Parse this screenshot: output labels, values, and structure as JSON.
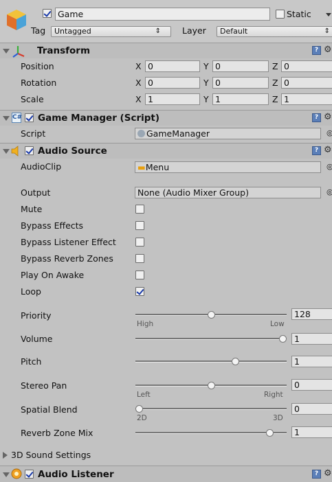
{
  "header": {
    "name": "Game",
    "static_label": "Static",
    "tag_label": "Tag",
    "tag_value": "Untagged",
    "layer_label": "Layer",
    "layer_value": "Default"
  },
  "transform": {
    "title": "Transform",
    "rows": [
      {
        "label": "Position",
        "x": "0",
        "y": "0",
        "z": "0"
      },
      {
        "label": "Rotation",
        "x": "0",
        "y": "0",
        "z": "0"
      },
      {
        "label": "Scale",
        "x": "1",
        "y": "1",
        "z": "1"
      }
    ],
    "axis_x": "X",
    "axis_y": "Y",
    "axis_z": "Z"
  },
  "game_manager": {
    "title": "Game Manager (Script)",
    "script_label": "Script",
    "script_value": "GameManager",
    "enabled": true
  },
  "audio_source": {
    "title": "Audio Source",
    "enabled": true,
    "audioclip_label": "AudioClip",
    "audioclip_value": "Menu",
    "output_label": "Output",
    "output_value": "None (Audio Mixer Group)",
    "toggles": [
      {
        "label": "Mute",
        "checked": false
      },
      {
        "label": "Bypass Effects",
        "checked": false
      },
      {
        "label": "Bypass Listener Effect",
        "checked": false
      },
      {
        "label": "Bypass Reverb Zones",
        "checked": false
      },
      {
        "label": "Play On Awake",
        "checked": false
      },
      {
        "label": "Loop",
        "checked": true
      }
    ],
    "sliders": {
      "priority": {
        "label": "Priority",
        "value": "128",
        "fraction": 0.5,
        "left": "High",
        "right": "Low"
      },
      "volume": {
        "label": "Volume",
        "value": "1",
        "fraction": 1.0
      },
      "pitch": {
        "label": "Pitch",
        "value": "1",
        "fraction": 0.67
      },
      "stereo_pan": {
        "label": "Stereo Pan",
        "value": "0",
        "fraction": 0.5,
        "left": "Left",
        "right": "Right"
      },
      "spatial_blend": {
        "label": "Spatial Blend",
        "value": "0",
        "fraction": 0.0,
        "left": "2D",
        "right": "3D"
      },
      "reverb_zone_mix": {
        "label": "Reverb Zone Mix",
        "value": "1",
        "fraction": 0.91
      }
    },
    "settings_3d_label": "3D Sound Settings"
  },
  "audio_listener": {
    "title": "Audio Listener",
    "enabled": true
  },
  "colors": {
    "panel": "#c2c2c2",
    "header": "#bdbdbd",
    "field": "#e4e4e4",
    "check": "#1a3aa8"
  },
  "icons": [
    "gameobject-cube-icon",
    "transform-axes-icon",
    "script-icon",
    "audio-source-speaker-icon",
    "audio-listener-icon",
    "help-book-icon",
    "gear-icon",
    "fold-arrow-icon",
    "object-picker-icon"
  ]
}
